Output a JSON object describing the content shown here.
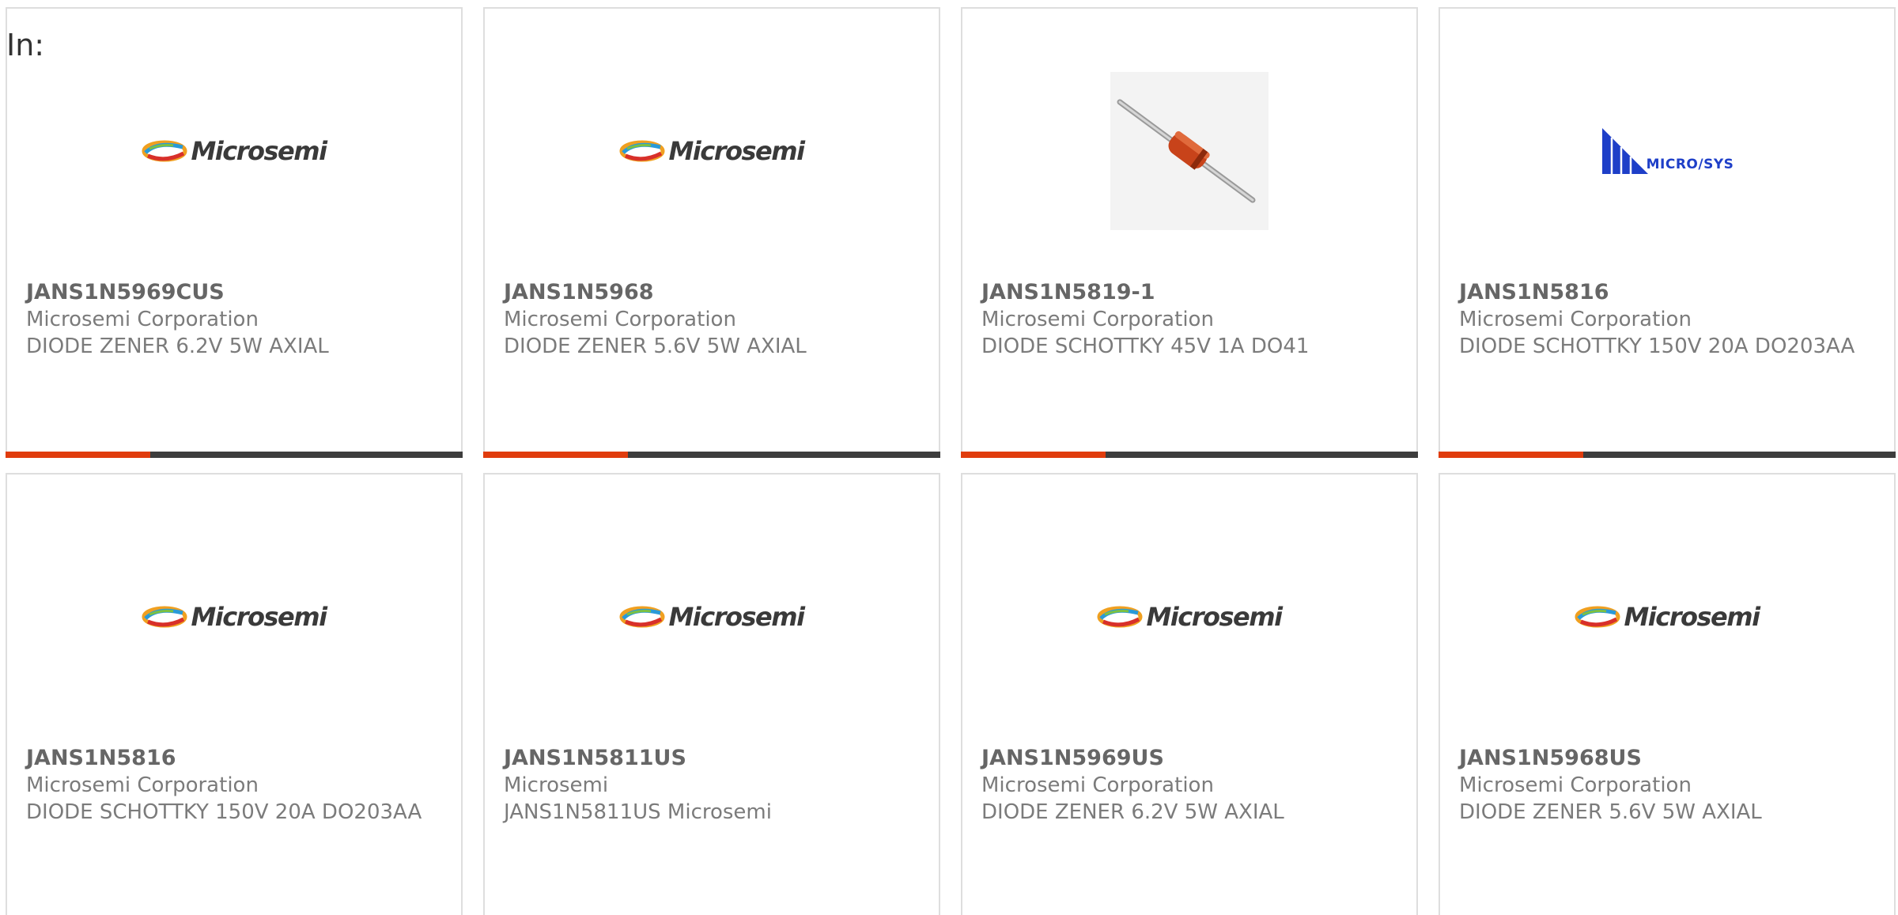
{
  "filter_label": "In:",
  "colors": {
    "accent": "#e03c0d",
    "bar": "#3d3d3d",
    "border": "#dedede",
    "microsys_blue": "#1e3fc8"
  },
  "logos": {
    "microsemi_wordmark": "Microsemi",
    "microsys_wordmark": "MICRO/SYS"
  },
  "products": [
    {
      "part_number": "JANS1N5969CUS",
      "manufacturer": "Microsemi Corporation",
      "description": "DIODE ZENER 6.2V 5W AXIAL",
      "image": "microsemi-logo"
    },
    {
      "part_number": "JANS1N5968",
      "manufacturer": "Microsemi Corporation",
      "description": "DIODE ZENER 5.6V 5W AXIAL",
      "image": "microsemi-logo"
    },
    {
      "part_number": "JANS1N5819-1",
      "manufacturer": "Microsemi Corporation",
      "description": "DIODE SCHOTTKY 45V 1A DO41",
      "image": "diode-photo"
    },
    {
      "part_number": "JANS1N5816",
      "manufacturer": "Microsemi Corporation",
      "description": "DIODE SCHOTTKY 150V 20A DO203AA",
      "image": "microsys-logo"
    },
    {
      "part_number": "JANS1N5816",
      "manufacturer": "Microsemi Corporation",
      "description": "DIODE SCHOTTKY 150V 20A DO203AA",
      "image": "microsemi-logo"
    },
    {
      "part_number": "JANS1N5811US",
      "manufacturer": "Microsemi",
      "description": "JANS1N5811US Microsemi",
      "image": "microsemi-logo"
    },
    {
      "part_number": "JANS1N5969US",
      "manufacturer": "Microsemi Corporation",
      "description": "DIODE ZENER 6.2V 5W AXIAL",
      "image": "microsemi-logo"
    },
    {
      "part_number": "JANS1N5968US",
      "manufacturer": "Microsemi Corporation",
      "description": "DIODE ZENER 5.6V 5W AXIAL",
      "image": "microsemi-logo"
    }
  ]
}
